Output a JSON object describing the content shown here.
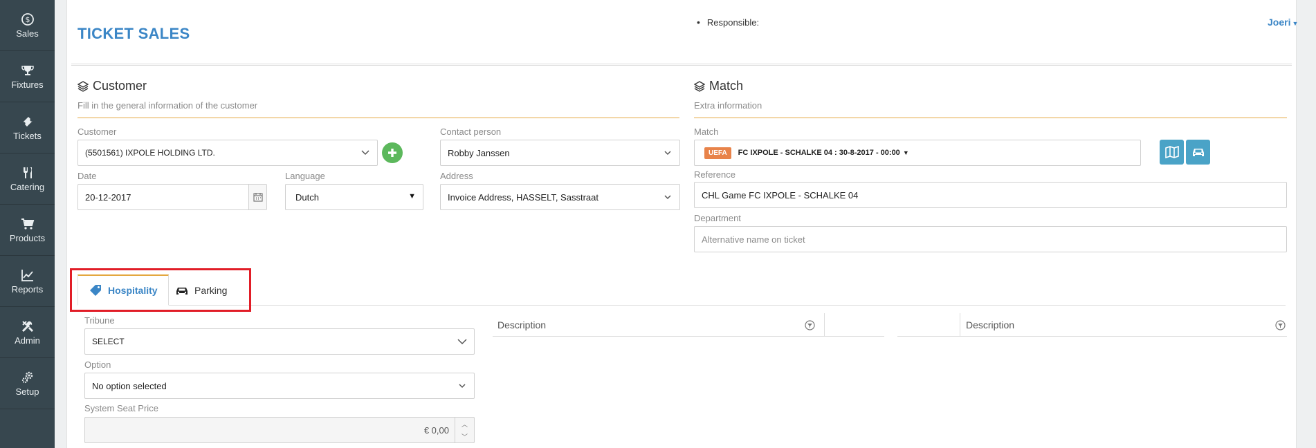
{
  "sidebar": {
    "items": [
      {
        "label": "Sales",
        "icon": "dollar-circle-icon"
      },
      {
        "label": "Fixtures",
        "icon": "trophy-icon"
      },
      {
        "label": "Tickets",
        "icon": "ticket-icon"
      },
      {
        "label": "Catering",
        "icon": "cutlery-icon"
      },
      {
        "label": "Products",
        "icon": "cart-icon"
      },
      {
        "label": "Reports",
        "icon": "line-chart-icon"
      },
      {
        "label": "Admin",
        "icon": "tools-icon"
      },
      {
        "label": "Setup",
        "icon": "gears-icon"
      }
    ]
  },
  "header": {
    "title": "TICKET SALES",
    "responsible_label": "Responsible:",
    "user": "Joeri"
  },
  "customer_section": {
    "title": "Customer",
    "subtitle": "Fill in the general information of the customer",
    "customer_label": "Customer",
    "customer_value": "(5501561) IXPOLE HOLDING LTD.",
    "contact_label": "Contact person",
    "contact_value": "Robby Janssen",
    "date_label": "Date",
    "date_value": "20-12-2017",
    "language_label": "Language",
    "language_value": "Dutch",
    "address_label": "Address",
    "address_value": "Invoice Address, HASSELT, Sasstraat"
  },
  "match_section": {
    "title": "Match",
    "subtitle": "Extra information",
    "match_label": "Match",
    "match_badge": "UEFA",
    "match_value": "FC IXPOLE - SCHALKE 04 : 30-8-2017 - 00:00",
    "reference_label": "Reference",
    "reference_value": "CHL Game FC IXPOLE - SCHALKE 04",
    "department_label": "Department",
    "department_placeholder": "Alternative name on ticket"
  },
  "tabs": [
    {
      "label": "Hospitality",
      "icon": "tag-icon",
      "active": true
    },
    {
      "label": "Parking",
      "icon": "car-icon",
      "active": false
    }
  ],
  "hospitality": {
    "tribune_label": "Tribune",
    "tribune_value": "SELECT",
    "option_label": "Option",
    "option_value": "No option selected",
    "seat_price_label": "System Seat Price",
    "seat_price_value": "€ 0,00"
  },
  "grids": {
    "left_header": "Description",
    "right_header": "Description"
  },
  "colors": {
    "sidebar": "#37474f",
    "accent_blue": "#3b86c6",
    "accent_orange": "#e4a73f",
    "add_green": "#5cb85c",
    "button_teal": "#4aa3c7",
    "badge_orange": "#e8834a",
    "highlight_red": "#e11d27"
  }
}
